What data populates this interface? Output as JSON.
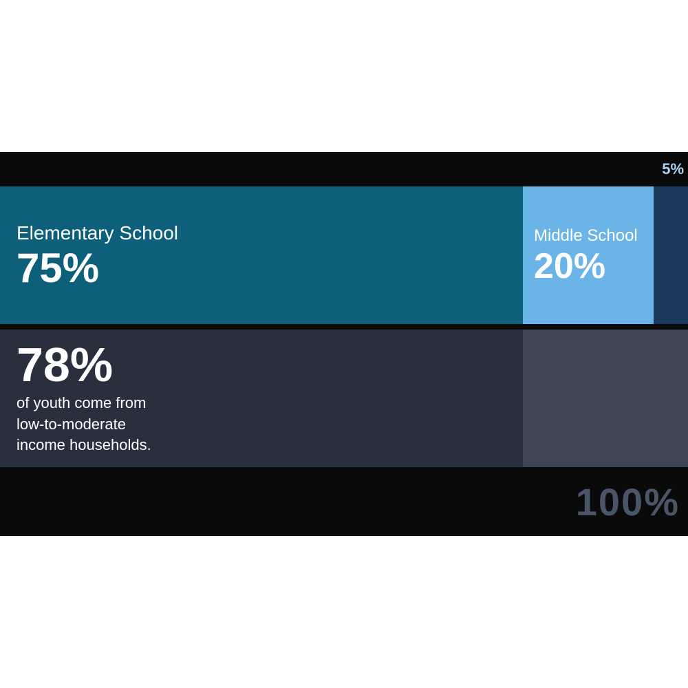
{
  "chart": {
    "top_bar": {
      "label_5pct": "5%"
    },
    "school_row": {
      "elementary": {
        "label": "Elementary School",
        "percentage": "75%",
        "width_pct": 76
      },
      "middle": {
        "label": "Middle School",
        "percentage": "20%",
        "width_pct": 19
      },
      "high": {
        "width_pct": 5
      }
    },
    "income_row": {
      "percentage": "78%",
      "description_line1": "of youth come from",
      "description_line2": "low-to-moderate",
      "description_line3": "income households."
    },
    "bottom_bar": {
      "label_100pct": "100%"
    }
  }
}
